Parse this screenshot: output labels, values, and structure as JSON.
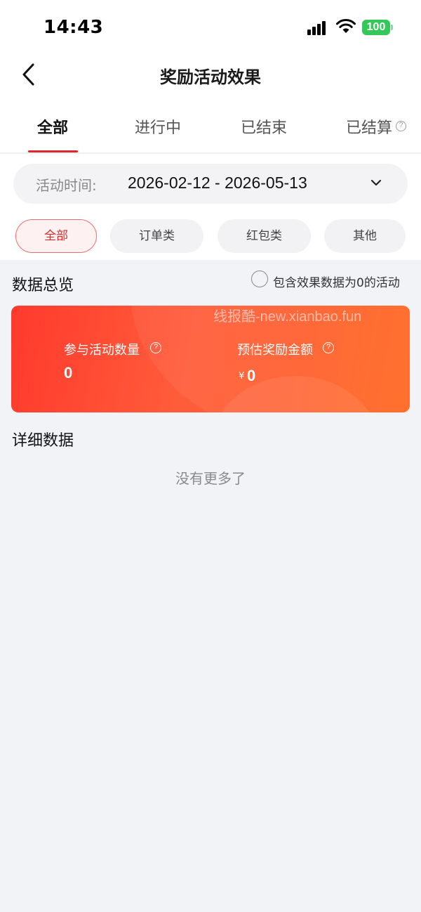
{
  "status_bar": {
    "time": "14:43",
    "battery": "100",
    "colors": {
      "battery": "#34c759"
    }
  },
  "nav": {
    "title": "奖励活动效果"
  },
  "tabs": [
    {
      "label": "全部"
    },
    {
      "label": "进行中"
    },
    {
      "label": "已结束"
    },
    {
      "label": "已结算"
    }
  ],
  "tab_help_symbol": "?",
  "date_filter": {
    "label": "活动时间:",
    "value": "2026-02-12 - 2026-05-13"
  },
  "chips": [
    {
      "label": "全部"
    },
    {
      "label": "订单类"
    },
    {
      "label": "红包类"
    },
    {
      "label": "其他"
    }
  ],
  "overview": {
    "title": "数据总览",
    "include_zero_label": "包含效果数据为0的活动",
    "watermark": "线报酷-new.xianbao.fun",
    "stats": [
      {
        "label": "参与活动数量",
        "value": "0"
      },
      {
        "label": "预估奖励金额",
        "currency": "¥",
        "value": "0"
      }
    ],
    "help_symbol": "?"
  },
  "details": {
    "title": "详细数据",
    "empty_text": "没有更多了"
  },
  "colors": {
    "accent": "#e0262b",
    "card_start": "#ff3a2d",
    "card_end": "#ff6820",
    "background": "#f2f3f7"
  }
}
